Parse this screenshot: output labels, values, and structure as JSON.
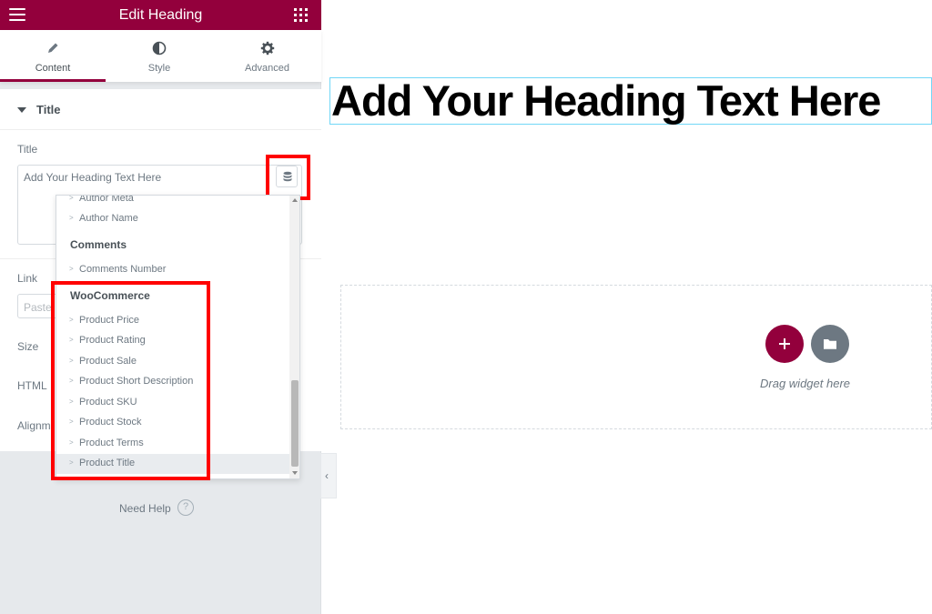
{
  "header": {
    "title": "Edit Heading"
  },
  "tabs": [
    {
      "label": "Content",
      "icon": "pencil-icon"
    },
    {
      "label": "Style",
      "icon": "half-circle-icon"
    },
    {
      "label": "Advanced",
      "icon": "gear-icon"
    }
  ],
  "section": {
    "title": "Title"
  },
  "controls": {
    "title_label": "Title",
    "title_value": "Add Your Heading Text Here",
    "link_label": "Link",
    "link_placeholder": "Paste",
    "size_label": "Size",
    "html_label": "HTML",
    "alignment_label": "Alignm"
  },
  "dropdown": {
    "items": [
      {
        "text": "Author Meta",
        "group": false
      },
      {
        "text": "Author Name",
        "group": false
      },
      {
        "text": "Comments",
        "group": true
      },
      {
        "text": "Comments Number",
        "group": false
      },
      {
        "text": "WooCommerce",
        "group": true
      },
      {
        "text": "Product Price",
        "group": false
      },
      {
        "text": "Product Rating",
        "group": false
      },
      {
        "text": "Product Sale",
        "group": false
      },
      {
        "text": "Product Short Description",
        "group": false
      },
      {
        "text": "Product SKU",
        "group": false
      },
      {
        "text": "Product Stock",
        "group": false
      },
      {
        "text": "Product Terms",
        "group": false
      },
      {
        "text": "Product Title",
        "group": false,
        "selected": true
      }
    ],
    "chevron": ">"
  },
  "footer": {
    "need_help": "Need Help",
    "help_icon": "?"
  },
  "canvas": {
    "heading": "Add Your Heading Text Here",
    "drag_text": "Drag widget here"
  },
  "colors": {
    "brand": "#93003c",
    "highlight": "#ff0000",
    "heading_outline": "#71d7f7"
  }
}
